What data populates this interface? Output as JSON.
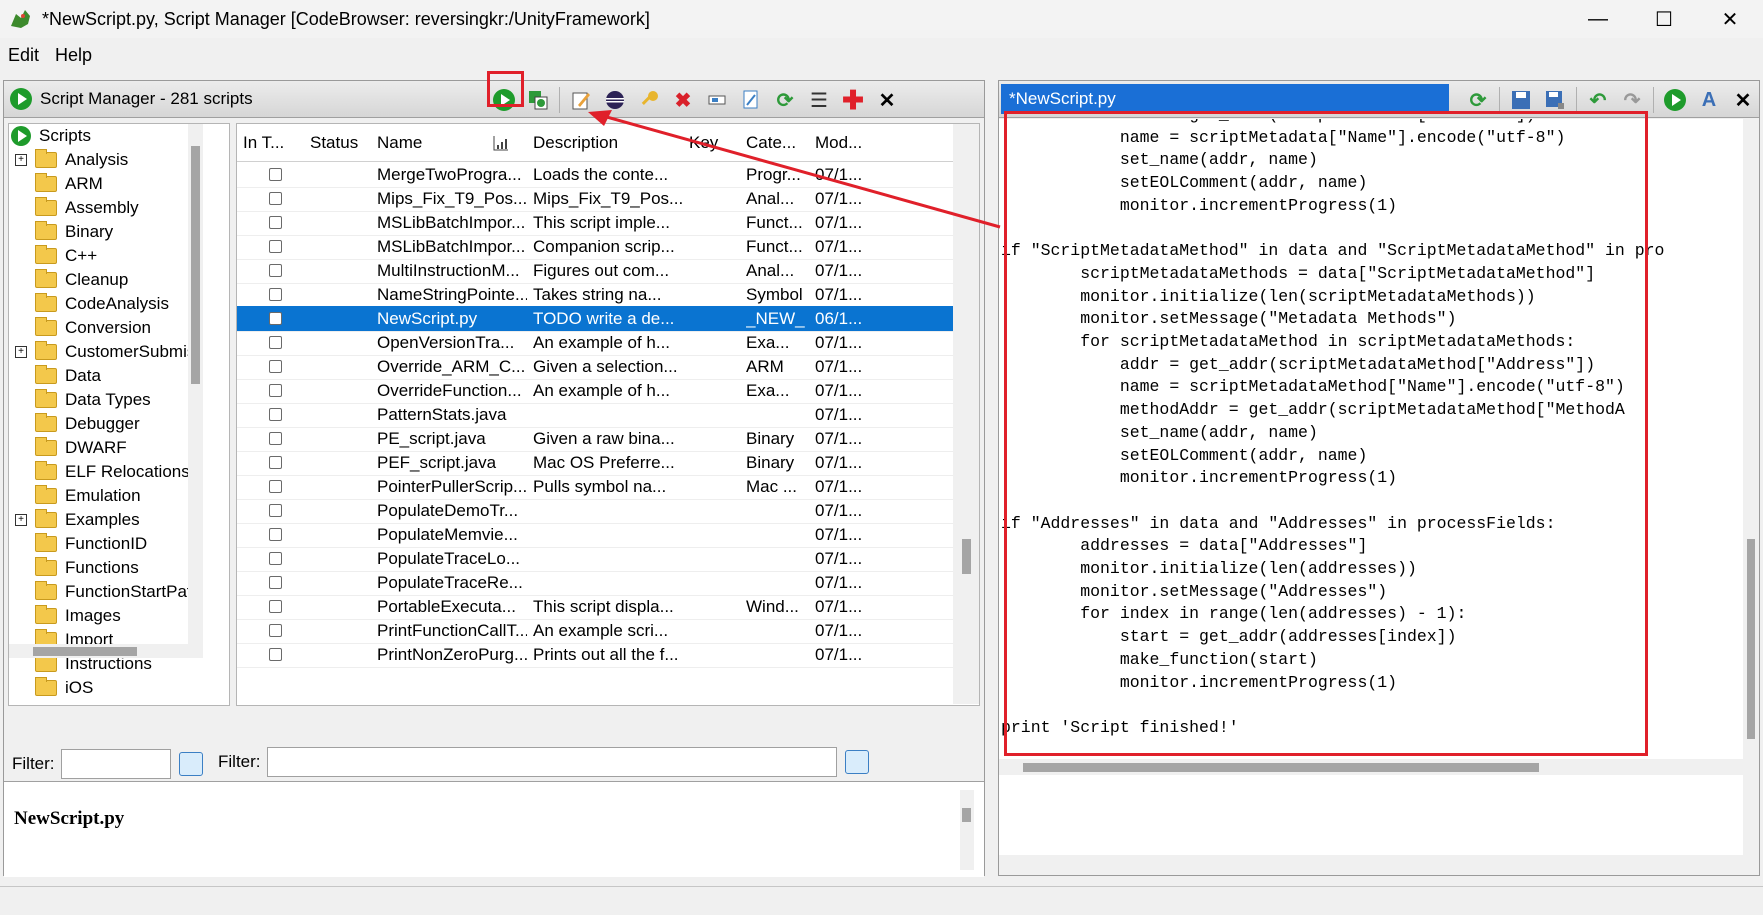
{
  "window": {
    "title": "*NewScript.py, Script Manager [CodeBrowser: reversingkr:/UnityFramework]",
    "minimize": "—",
    "maximize": "☐",
    "close": "✕"
  },
  "menu": {
    "edit": "Edit",
    "help": "Help"
  },
  "script_manager": {
    "title": "Script Manager - 281 scripts",
    "toolbar_icons": [
      "run-script-icon",
      "run-last-script-icon",
      "edit-script-icon",
      "eclipse-icon",
      "key-binding-icon",
      "delete-script-icon",
      "rename-icon",
      "new-script-icon",
      "refresh-icon",
      "script-dirs-icon",
      "help-icon",
      "close-icon"
    ],
    "tree": {
      "root": "Scripts",
      "items": [
        "Analysis",
        "ARM",
        "Assembly",
        "Binary",
        "C++",
        "Cleanup",
        "CodeAnalysis",
        "Conversion",
        "CustomerSubmis",
        "Data",
        "Data Types",
        "Debugger",
        "DWARF",
        "ELF Relocations",
        "Emulation",
        "Examples",
        "FunctionID",
        "Functions",
        "FunctionStartPat",
        "Images",
        "Import",
        "Instructions",
        "iOS"
      ]
    },
    "table": {
      "columns": [
        "In T...",
        "Status",
        "Name",
        "Description",
        "Key",
        "Cate...",
        "Mod..."
      ],
      "rows": [
        {
          "name": "MergeTwoProgra...",
          "desc": "Loads the conte...",
          "cat": "Progr...",
          "mod": "07/1..."
        },
        {
          "name": "Mips_Fix_T9_Pos...",
          "desc": "Mips_Fix_T9_Pos...",
          "cat": "Anal...",
          "mod": "07/1..."
        },
        {
          "name": "MSLibBatchImpor...",
          "desc": "This script imple...",
          "cat": "Funct...",
          "mod": "07/1..."
        },
        {
          "name": "MSLibBatchImpor...",
          "desc": "Companion scrip...",
          "cat": "Funct...",
          "mod": "07/1..."
        },
        {
          "name": "MultiInstructionM...",
          "desc": "Figures out com...",
          "cat": "Anal...",
          "mod": "07/1..."
        },
        {
          "name": "NameStringPointe...",
          "desc": "Takes string na...",
          "cat": "Symbol",
          "mod": "07/1..."
        },
        {
          "name": "NewScript.py",
          "desc": "TODO write a de...",
          "cat": "_NEW_",
          "mod": "06/1..."
        },
        {
          "name": "OpenVersionTra...",
          "desc": "An example of h...",
          "cat": "Exa...",
          "mod": "07/1..."
        },
        {
          "name": "Override_ARM_C...",
          "desc": "Given a selection...",
          "cat": "ARM",
          "mod": "07/1..."
        },
        {
          "name": "OverrideFunction...",
          "desc": "An example of h...",
          "cat": "Exa...",
          "mod": "07/1..."
        },
        {
          "name": "PatternStats.java",
          "desc": "",
          "cat": "",
          "mod": "07/1..."
        },
        {
          "name": "PE_script.java",
          "desc": "Given a raw bina...",
          "cat": "Binary",
          "mod": "07/1..."
        },
        {
          "name": "PEF_script.java",
          "desc": "Mac OS Preferre...",
          "cat": "Binary",
          "mod": "07/1..."
        },
        {
          "name": "PointerPullerScrip...",
          "desc": "Pulls symbol na...",
          "cat": "Mac ...",
          "mod": "07/1..."
        },
        {
          "name": "PopulateDemoTr...",
          "desc": "",
          "cat": "",
          "mod": "07/1..."
        },
        {
          "name": "PopulateMemvie...",
          "desc": "",
          "cat": "",
          "mod": "07/1..."
        },
        {
          "name": "PopulateTraceLo...",
          "desc": "",
          "cat": "",
          "mod": "07/1..."
        },
        {
          "name": "PopulateTraceRe...",
          "desc": "",
          "cat": "",
          "mod": "07/1..."
        },
        {
          "name": "PortableExecuta...",
          "desc": "This script displa...",
          "cat": "Wind...",
          "mod": "07/1..."
        },
        {
          "name": "PrintFunctionCallT...",
          "desc": "An example scri...",
          "cat": "",
          "mod": "07/1..."
        },
        {
          "name": "PrintNonZeroPurg...",
          "desc": "Prints out all the f...",
          "cat": "",
          "mod": "07/1..."
        }
      ],
      "selected_index": 6
    },
    "filter_label": "Filter:",
    "description_title": "NewScript.py"
  },
  "editor": {
    "tab": "*NewScript.py",
    "toolbar_icons": [
      "refresh-icon",
      "save-icon",
      "save-as-icon",
      "undo-icon",
      "redo-icon",
      "run-icon",
      "font-icon",
      "close-icon"
    ],
    "lines": [
      "            addr = get_addr(scriptMetadata[\"Address\"])",
      "            name = scriptMetadata[\"Name\"].encode(\"utf-8\")",
      "            set_name(addr, name)",
      "            setEOLComment(addr, name)",
      "            monitor.incrementProgress(1)",
      "",
      "if \"ScriptMetadataMethod\" in data and \"ScriptMetadataMethod\" in pro",
      "        scriptMetadataMethods = data[\"ScriptMetadataMethod\"]",
      "        monitor.initialize(len(scriptMetadataMethods))",
      "        monitor.setMessage(\"Metadata Methods\")",
      "        for scriptMetadataMethod in scriptMetadataMethods:",
      "            addr = get_addr(scriptMetadataMethod[\"Address\"])",
      "            name = scriptMetadataMethod[\"Name\"].encode(\"utf-8\")",
      "            methodAddr = get_addr(scriptMetadataMethod[\"MethodA",
      "            set_name(addr, name)",
      "            setEOLComment(addr, name)",
      "            monitor.incrementProgress(1)",
      "",
      "if \"Addresses\" in data and \"Addresses\" in processFields:",
      "        addresses = data[\"Addresses\"]",
      "        monitor.initialize(len(addresses))",
      "        monitor.setMessage(\"Addresses\")",
      "        for index in range(len(addresses) - 1):",
      "            start = get_addr(addresses[index])",
      "            make_function(start)",
      "            monitor.incrementProgress(1)",
      "",
      "print 'Script finished!'"
    ]
  },
  "colors": {
    "accent": "#1a6fd6",
    "selection": "#0a74d1",
    "annotation": "#e0202a"
  }
}
